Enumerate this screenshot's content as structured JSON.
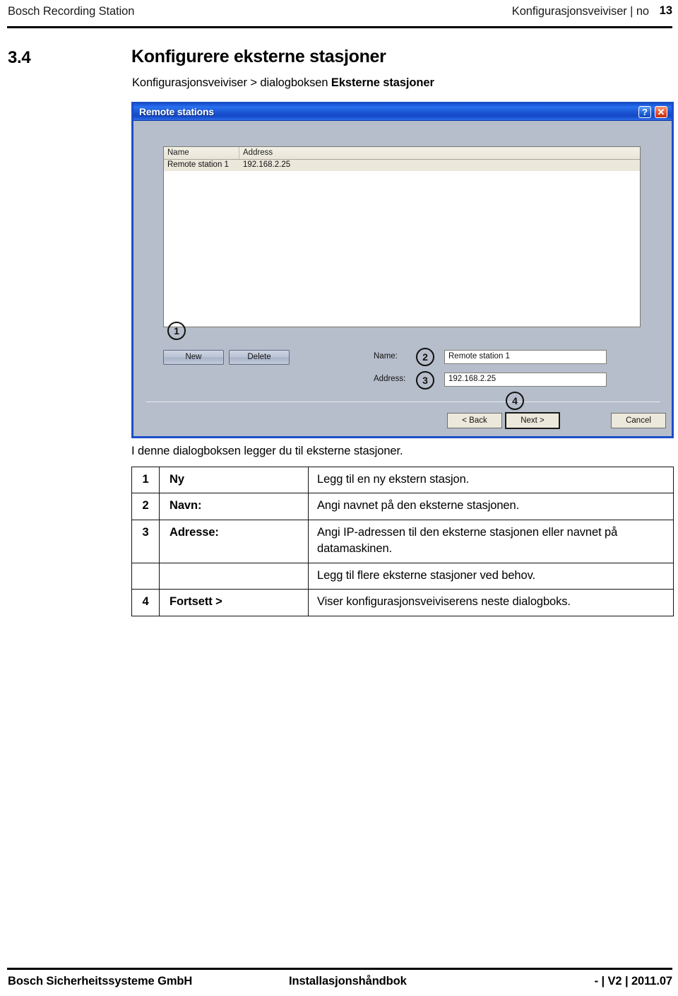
{
  "page_header": {
    "left_title": "Bosch Recording Station",
    "right_title": "Konfigurasjonsveiviser | no",
    "page_number": "13"
  },
  "section": {
    "number": "3.4",
    "title": "Konfigurere eksterne stasjoner",
    "breadcrumb_prefix": "Konfigurasjonsveiviser > dialogboksen ",
    "breadcrumb_bold": "Eksterne stasjoner"
  },
  "dialog": {
    "title": "Remote stations",
    "help_icon": "?",
    "close_icon": "✕",
    "list": {
      "columns": [
        "Name",
        "Address"
      ],
      "rows": [
        {
          "name": "Remote station 1",
          "address": "192.168.2.25"
        }
      ]
    },
    "buttons": {
      "new": "New",
      "delete": "Delete",
      "back": "< Back",
      "next": "Next >",
      "cancel": "Cancel"
    },
    "fields": {
      "name_label": "Name:",
      "name_value": "Remote station 1",
      "address_label": "Address:",
      "address_value": "192.168.2.25"
    },
    "callouts": [
      "1",
      "2",
      "3",
      "4"
    ],
    "colors": {
      "titlebar_blue": "#1b54d2",
      "body_gray": "#b6bdcb",
      "border_blue": "#1b4fc9",
      "selected_row": "#ebe7da"
    }
  },
  "intro_text": "I denne dialogboksen legger du til eksterne stasjoner.",
  "description_table": {
    "rows": [
      {
        "num": "1",
        "label": "Ny",
        "desc": "Legg til en ny ekstern stasjon."
      },
      {
        "num": "2",
        "label": "Navn:",
        "desc": "Angi navnet på den eksterne stasjonen."
      },
      {
        "num": "3",
        "label": "Adresse:",
        "desc": "Angi IP-adressen til den eksterne stasjonen eller navnet på datamaskinen."
      },
      {
        "num": "",
        "label": "",
        "desc": "Legg til flere eksterne stasjoner ved behov."
      },
      {
        "num": "4",
        "label": "Fortsett >",
        "desc": "Viser konfigurasjonsveiviserens neste dialogboks."
      }
    ]
  },
  "page_footer": {
    "left": "Bosch Sicherheitssysteme GmbH",
    "center": "Installasjonshåndbok",
    "right": "- | V2 | 2011.07"
  }
}
